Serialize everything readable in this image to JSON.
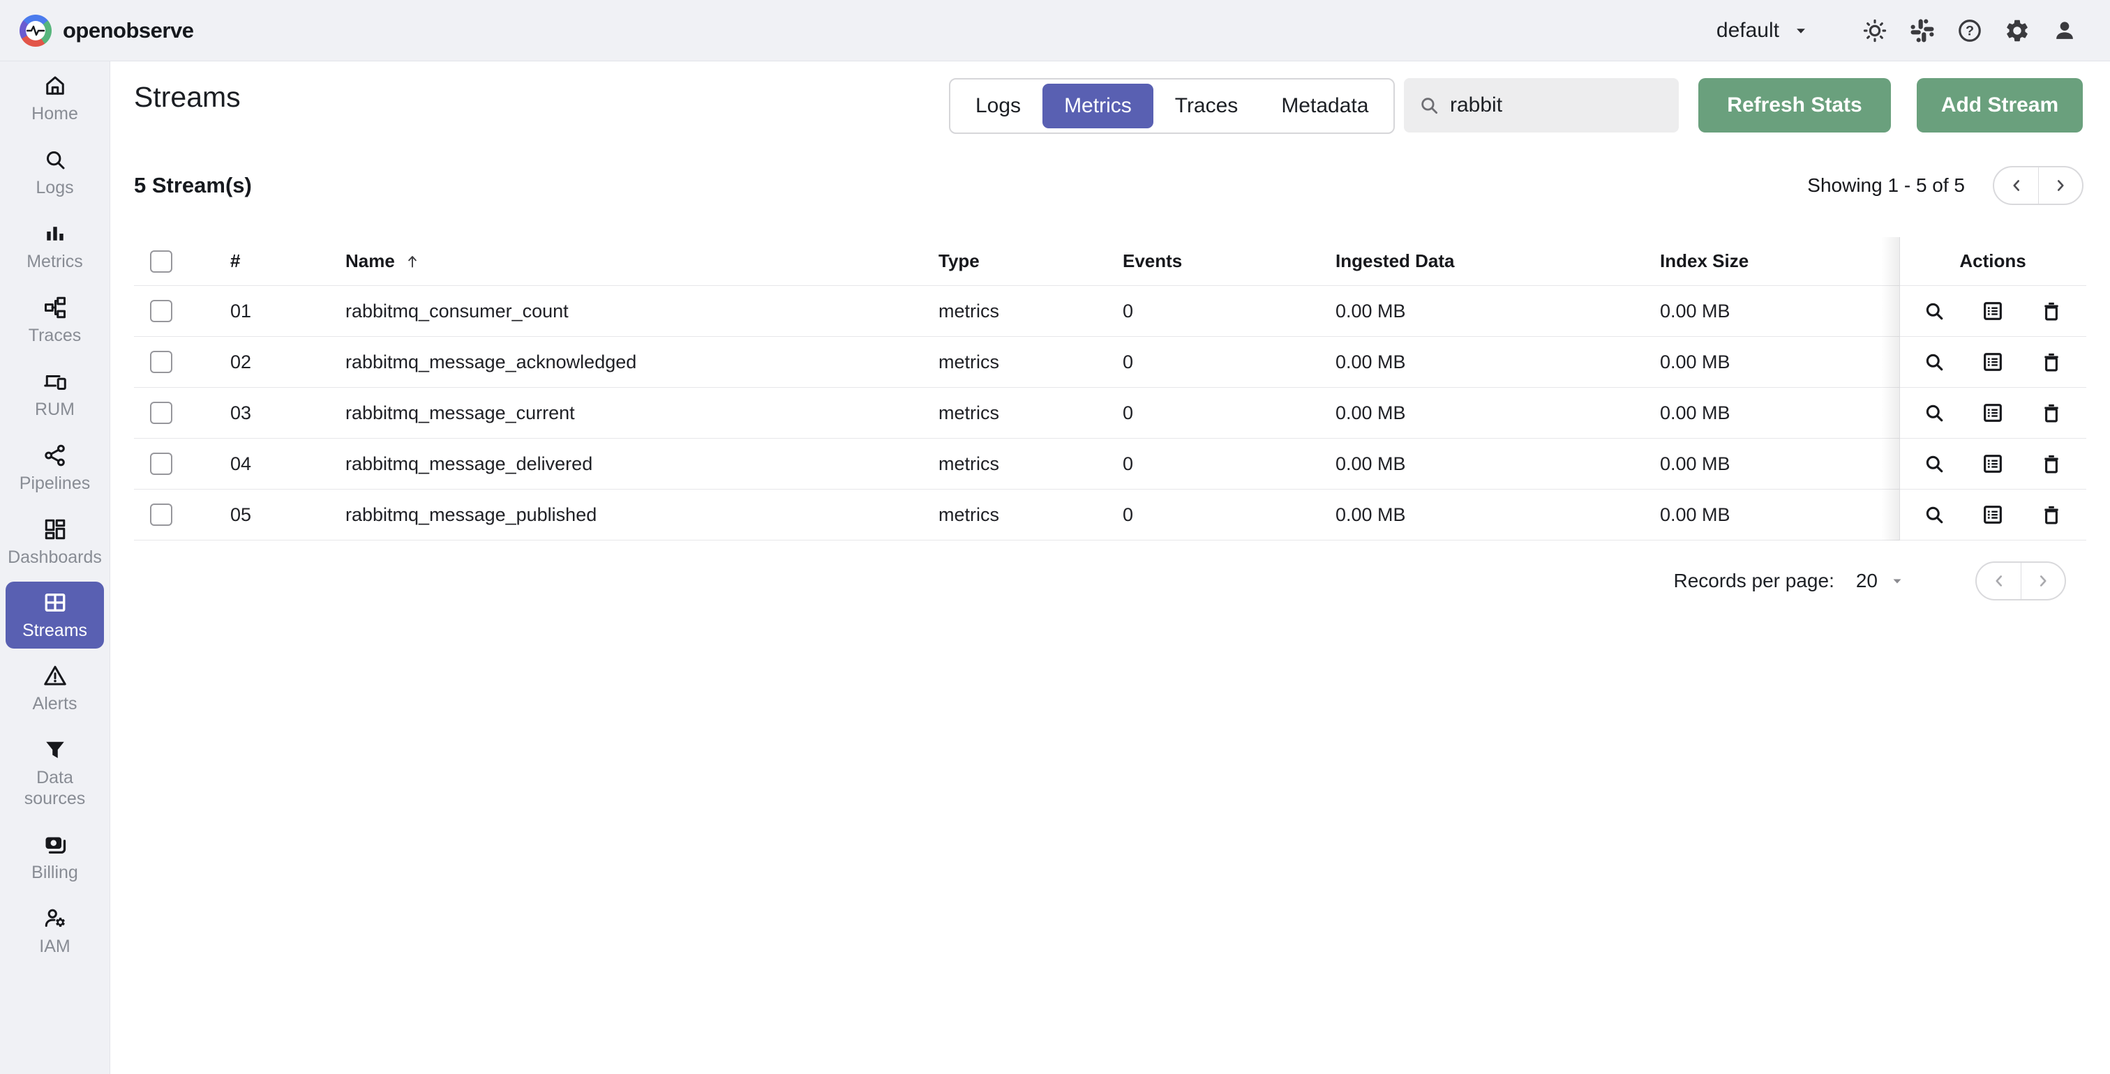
{
  "colors": {
    "accent_purple": "#5960b2",
    "button_green": "#6aa07d"
  },
  "topbar": {
    "brand": "openobserve",
    "org_label": "default",
    "icons": [
      "sun-icon",
      "slack-icon",
      "help-icon",
      "gear-icon",
      "person-icon"
    ]
  },
  "sidebar": {
    "items": [
      {
        "label": "Home",
        "icon": "home",
        "active": false
      },
      {
        "label": "Logs",
        "icon": "search",
        "active": false
      },
      {
        "label": "Metrics",
        "icon": "metrics",
        "active": false
      },
      {
        "label": "Traces",
        "icon": "traces",
        "active": false
      },
      {
        "label": "RUM",
        "icon": "rum",
        "active": false
      },
      {
        "label": "Pipelines",
        "icon": "pipelines",
        "active": false
      },
      {
        "label": "Dashboards",
        "icon": "dashboards",
        "active": false
      },
      {
        "label": "Streams",
        "icon": "streams",
        "active": true
      },
      {
        "label": "Alerts",
        "icon": "alerts",
        "active": false
      },
      {
        "label": "Data sources",
        "icon": "datasources",
        "active": false,
        "tall": true
      },
      {
        "label": "Billing",
        "icon": "billing",
        "active": false
      },
      {
        "label": "IAM",
        "icon": "iam",
        "active": false
      }
    ]
  },
  "page": {
    "title": "Streams",
    "tabs": [
      {
        "label": "Logs",
        "active": false
      },
      {
        "label": "Metrics",
        "active": true
      },
      {
        "label": "Traces",
        "active": false
      },
      {
        "label": "Metadata",
        "active": false
      }
    ],
    "search_value": "rabbit",
    "refresh_label": "Refresh Stats",
    "add_label": "Add Stream",
    "count_label": "5 Stream(s)",
    "showing_label": "Showing 1 - 5 of 5",
    "records_label": "Records per page:",
    "records_value": "20",
    "table": {
      "headers": {
        "number": "#",
        "name": "Name",
        "type": "Type",
        "events": "Events",
        "ingested": "Ingested Data",
        "index": "Index Size",
        "actions": "Actions"
      },
      "rows": [
        {
          "num": "01",
          "name": "rabbitmq_consumer_count",
          "type": "metrics",
          "events": "0",
          "ingested": "0.00 MB",
          "index": "0.00 MB"
        },
        {
          "num": "02",
          "name": "rabbitmq_message_acknowledged",
          "type": "metrics",
          "events": "0",
          "ingested": "0.00 MB",
          "index": "0.00 MB"
        },
        {
          "num": "03",
          "name": "rabbitmq_message_current",
          "type": "metrics",
          "events": "0",
          "ingested": "0.00 MB",
          "index": "0.00 MB"
        },
        {
          "num": "04",
          "name": "rabbitmq_message_delivered",
          "type": "metrics",
          "events": "0",
          "ingested": "0.00 MB",
          "index": "0.00 MB"
        },
        {
          "num": "05",
          "name": "rabbitmq_message_published",
          "type": "metrics",
          "events": "0",
          "ingested": "0.00 MB",
          "index": "0.00 MB"
        }
      ]
    }
  }
}
